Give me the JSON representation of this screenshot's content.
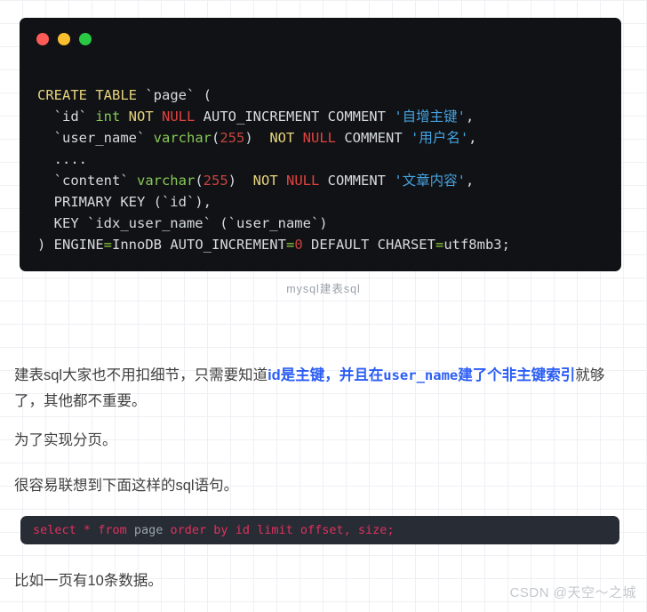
{
  "window": {
    "dots": [
      {
        "name": "close-dot",
        "color": "#fc5b57"
      },
      {
        "name": "minimize-dot",
        "color": "#fbbe2f"
      },
      {
        "name": "maximize-dot",
        "color": "#2ac943"
      }
    ]
  },
  "code_block": {
    "language": "sql",
    "background": "#101215",
    "lines": [
      {
        "id": "line-1",
        "tokens": [
          {
            "t": "CREATE TABLE",
            "c": "kw"
          },
          {
            "t": " ",
            "c": "plain"
          },
          {
            "t": "`page`",
            "c": "plain"
          },
          {
            "t": " (",
            "c": "plain"
          }
        ]
      },
      {
        "id": "line-2",
        "tokens": [
          {
            "t": "  `id` ",
            "c": "plain"
          },
          {
            "t": "int",
            "c": "type"
          },
          {
            "t": " ",
            "c": "plain"
          },
          {
            "t": "NOT",
            "c": "kw"
          },
          {
            "t": " ",
            "c": "plain"
          },
          {
            "t": "NULL",
            "c": "null"
          },
          {
            "t": " AUTO_INCREMENT COMMENT ",
            "c": "plain"
          },
          {
            "t": "'自增主键'",
            "c": "str"
          },
          {
            "t": ",",
            "c": "plain"
          }
        ]
      },
      {
        "id": "line-3",
        "tokens": [
          {
            "t": "  `user_name` ",
            "c": "plain"
          },
          {
            "t": "varchar",
            "c": "type"
          },
          {
            "t": "(",
            "c": "plain"
          },
          {
            "t": "255",
            "c": "num"
          },
          {
            "t": ")  ",
            "c": "plain"
          },
          {
            "t": "NOT",
            "c": "kw"
          },
          {
            "t": " ",
            "c": "plain"
          },
          {
            "t": "NULL",
            "c": "null"
          },
          {
            "t": " COMMENT ",
            "c": "plain"
          },
          {
            "t": "'用户名'",
            "c": "str"
          },
          {
            "t": ",",
            "c": "plain"
          }
        ]
      },
      {
        "id": "line-4",
        "tokens": [
          {
            "t": "  ....",
            "c": "plain"
          }
        ]
      },
      {
        "id": "line-5",
        "tokens": [
          {
            "t": "  `content` ",
            "c": "plain"
          },
          {
            "t": "varchar",
            "c": "type"
          },
          {
            "t": "(",
            "c": "plain"
          },
          {
            "t": "255",
            "c": "num"
          },
          {
            "t": ")  ",
            "c": "plain"
          },
          {
            "t": "NOT",
            "c": "kw"
          },
          {
            "t": " ",
            "c": "plain"
          },
          {
            "t": "NULL",
            "c": "null"
          },
          {
            "t": " COMMENT ",
            "c": "plain"
          },
          {
            "t": "'文章内容'",
            "c": "str"
          },
          {
            "t": ",",
            "c": "plain"
          }
        ]
      },
      {
        "id": "line-6",
        "tokens": [
          {
            "t": "  PRIMARY KEY (`id`),",
            "c": "plain"
          }
        ]
      },
      {
        "id": "line-7",
        "tokens": [
          {
            "t": "  KEY `idx_user_name` (`user_name`)",
            "c": "plain"
          }
        ]
      },
      {
        "id": "line-8",
        "tokens": [
          {
            "t": ") ENGINE",
            "c": "plain"
          },
          {
            "t": "=",
            "c": "op"
          },
          {
            "t": "InnoDB AUTO_INCREMENT",
            "c": "plain"
          },
          {
            "t": "=",
            "c": "op"
          },
          {
            "t": "0",
            "c": "num"
          },
          {
            "t": " DEFAULT CHARSET",
            "c": "plain"
          },
          {
            "t": "=",
            "c": "op"
          },
          {
            "t": "utf8mb3;",
            "c": "plain"
          }
        ]
      }
    ]
  },
  "caption": "mysql建表sql",
  "paragraphs": {
    "p1_part1": "建表sql大家也不用扣细节，只需要知道",
    "p1_blue1": "id是主键，并且在",
    "p1_blue_mono": "user_name",
    "p1_blue2": "建了个非主键索引",
    "p1_part2": "就够了，其他都不重要。",
    "p2": "为了实现分页。",
    "p3": "很容易联想到下面这样的sql语句。",
    "p4": "比如一页有10条数据。"
  },
  "sql_snippet": {
    "background": "#282c34",
    "tokens": [
      {
        "t": "select",
        "c": "kw"
      },
      {
        "t": " ",
        "c": "id"
      },
      {
        "t": "*",
        "c": "kw"
      },
      {
        "t": " ",
        "c": "id"
      },
      {
        "t": "from",
        "c": "kw"
      },
      {
        "t": " ",
        "c": "id"
      },
      {
        "t": "page",
        "c": "id"
      },
      {
        "t": " ",
        "c": "id"
      },
      {
        "t": "order by",
        "c": "kw"
      },
      {
        "t": " ",
        "c": "id"
      },
      {
        "t": "id",
        "c": "kw"
      },
      {
        "t": " ",
        "c": "id"
      },
      {
        "t": "limit",
        "c": "kw"
      },
      {
        "t": " ",
        "c": "id"
      },
      {
        "t": "offset",
        "c": "kw"
      },
      {
        "t": ", ",
        "c": "punct"
      },
      {
        "t": "size",
        "c": "kw"
      },
      {
        "t": ";",
        "c": "punct"
      }
    ],
    "plain_text": "select * from page order by id limit offset, size;"
  },
  "watermark": "CSDN @天空～之城"
}
